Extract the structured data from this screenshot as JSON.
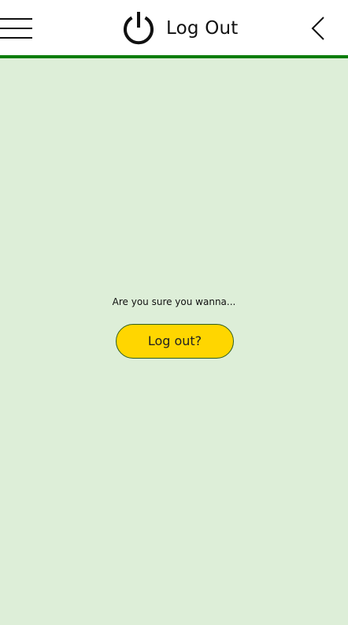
{
  "header": {
    "title": "Log Out",
    "menu_icon": "hamburger-menu-icon",
    "title_icon": "power-icon",
    "back_icon": "chevron-left-icon"
  },
  "main": {
    "prompt": "Are you sure you wanna...",
    "logout_button_label": "Log out?"
  },
  "colors": {
    "background": "#ddeed8",
    "header_border": "#0a7d0a",
    "button_fill": "#ffd600",
    "button_border": "#2e5e20"
  }
}
